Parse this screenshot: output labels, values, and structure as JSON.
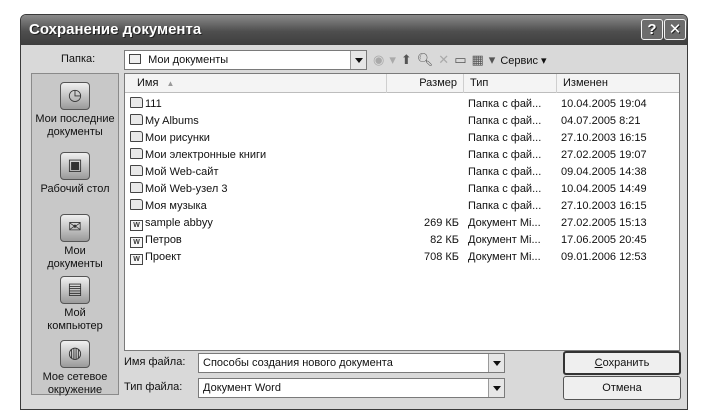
{
  "window": {
    "title": "Сохранение документа"
  },
  "folder_bar": {
    "label": "Папка:",
    "value": "Мои документы"
  },
  "toolbar": {
    "service_label": "Сервис"
  },
  "places": [
    {
      "line1": "Мои последние",
      "line2": "документы",
      "icon": "recent-documents-icon"
    },
    {
      "line1": "Рабочий стол",
      "line2": "",
      "icon": "desktop-icon"
    },
    {
      "line1": "Мои",
      "line2": "документы",
      "icon": "my-documents-icon"
    },
    {
      "line1": "Мой",
      "line2": "компьютер",
      "icon": "computer-icon"
    },
    {
      "line1": "Мое сетевое",
      "line2": "окружение",
      "icon": "network-icon"
    }
  ],
  "list": {
    "columns": {
      "name": "Имя",
      "size": "Размер",
      "type": "Тип",
      "date": "Изменен"
    },
    "rows": [
      {
        "name": "111",
        "size": "",
        "type": "Папка с фай...",
        "date": "10.04.2005 19:04",
        "kind": "folder"
      },
      {
        "name": "My Albums",
        "size": "",
        "type": "Папка с фай...",
        "date": "04.07.2005 8:21",
        "kind": "folder"
      },
      {
        "name": "Мои рисунки",
        "size": "",
        "type": "Папка с фай...",
        "date": "27.10.2003 16:15",
        "kind": "folder"
      },
      {
        "name": "Мои электронные книги",
        "size": "",
        "type": "Папка с фай...",
        "date": "27.02.2005 19:07",
        "kind": "folder"
      },
      {
        "name": "Мой  Web-сайт",
        "size": "",
        "type": "Папка с фай...",
        "date": "09.04.2005 14:38",
        "kind": "folder"
      },
      {
        "name": "Мой Web-узел 3",
        "size": "",
        "type": "Папка с фай...",
        "date": "10.04.2005 14:49",
        "kind": "folder"
      },
      {
        "name": "Моя музыка",
        "size": "",
        "type": "Папка с фай...",
        "date": "27.10.2003 16:15",
        "kind": "folder"
      },
      {
        "name": "sample abbyy",
        "size": "269 КБ",
        "type": "Документ Mi...",
        "date": "27.02.2005 15:13",
        "kind": "doc"
      },
      {
        "name": "Петров",
        "size": "82 КБ",
        "type": "Документ Mi...",
        "date": "17.06.2005 20:45",
        "kind": "doc"
      },
      {
        "name": "Проект",
        "size": "708 КБ",
        "type": "Документ Mi...",
        "date": "09.01.2006 12:53",
        "kind": "doc"
      }
    ]
  },
  "filename": {
    "label": "Имя файла:",
    "value": "Способы создания нового документа"
  },
  "filetype": {
    "label": "Тип файла:",
    "value": "Документ Word"
  },
  "buttons": {
    "save_first": "С",
    "save_rest": "охранить",
    "cancel": "Отмена"
  }
}
